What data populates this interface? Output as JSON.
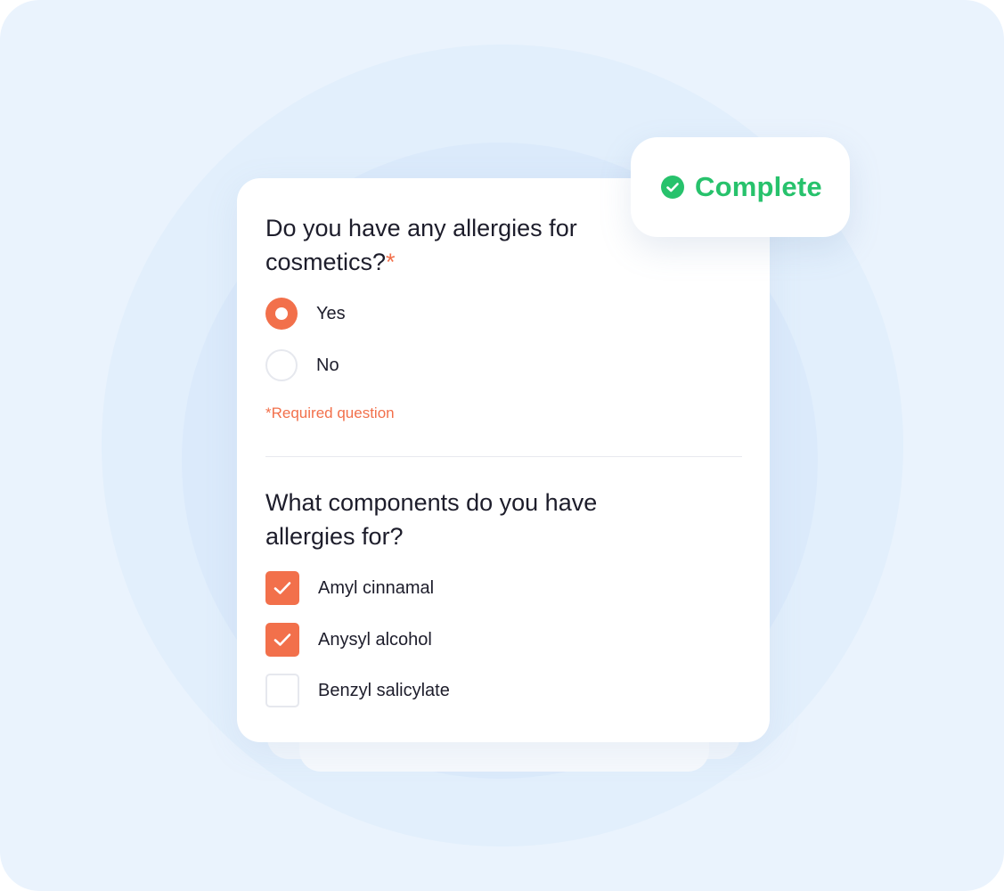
{
  "colors": {
    "accent": "#f2704b",
    "success": "#27c26c",
    "background": "#eaf3fd",
    "text": "#1d1d2b"
  },
  "status_badge": {
    "icon": "check-circle-icon",
    "label": "Complete"
  },
  "question_1": {
    "title": "Do you have any allergies for cosmetics?",
    "required_marker": "*",
    "options": [
      {
        "label": "Yes",
        "checked": true
      },
      {
        "label": "No",
        "checked": false
      }
    ],
    "required_note": "*Required question"
  },
  "question_2": {
    "title": "What components do you have allergies for?",
    "options": [
      {
        "label": "Amyl cinnamal",
        "checked": true
      },
      {
        "label": "Anysyl alcohol",
        "checked": true
      },
      {
        "label": "Benzyl salicylate",
        "checked": false
      }
    ]
  }
}
